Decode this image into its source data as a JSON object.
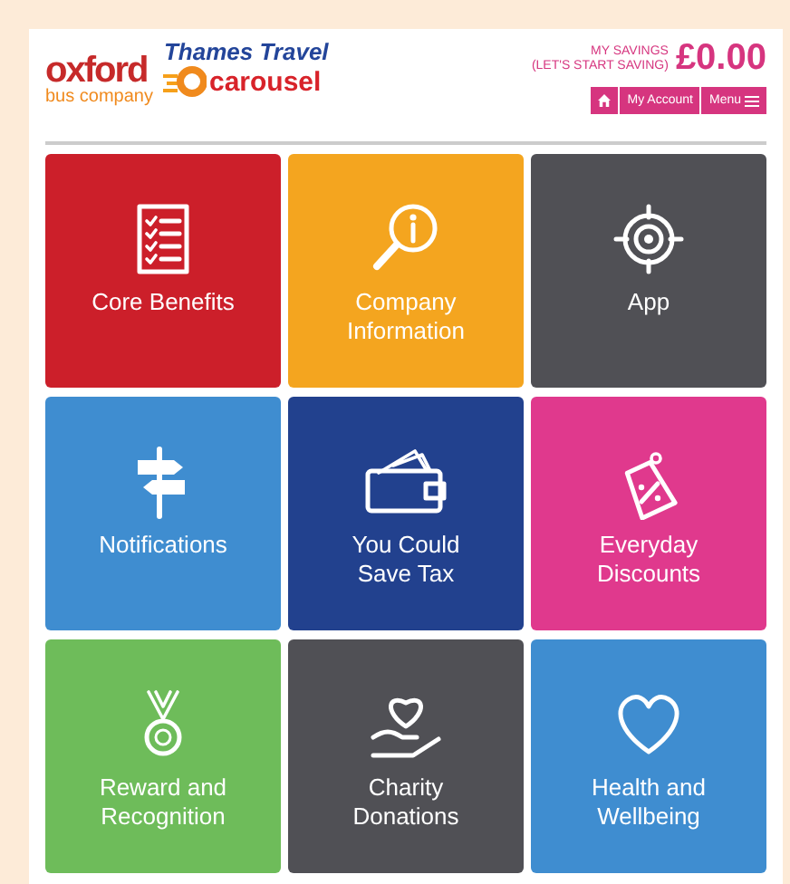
{
  "logos": {
    "oxford": "oxford",
    "oxford_sub": "bus company",
    "thames": "Thames Travel",
    "carousel": "carousel"
  },
  "savings": {
    "label": "MY SAVINGS",
    "sub": "(LET'S START SAVING)",
    "amount": "£0.00"
  },
  "nav": [
    {
      "kind": "home"
    },
    {
      "kind": "text",
      "label": "My Account"
    },
    {
      "kind": "menu",
      "label": "Menu"
    }
  ],
  "tiles": [
    {
      "label": "Core Benefits",
      "kind": "checklist",
      "color": "#cc1f2a"
    },
    {
      "label": "Company Information",
      "kind": "info",
      "color": "#f4a51f"
    },
    {
      "label": "App",
      "kind": "target",
      "color": "#505055"
    },
    {
      "label": "Notifications",
      "kind": "signpost",
      "color": "#3f8dd0"
    },
    {
      "label": "You Could Save Tax",
      "kind": "wallet",
      "color": "#22418e"
    },
    {
      "label": "Everyday Discounts",
      "kind": "tag",
      "color": "#e0398d"
    },
    {
      "label": "Reward and Recognition",
      "kind": "medal",
      "color": "#6ebc5a"
    },
    {
      "label": "Charity Donations",
      "kind": "hearthand",
      "color": "#505055"
    },
    {
      "label": "Health and Wellbeing",
      "kind": "heart",
      "color": "#3f8dd0"
    }
  ]
}
